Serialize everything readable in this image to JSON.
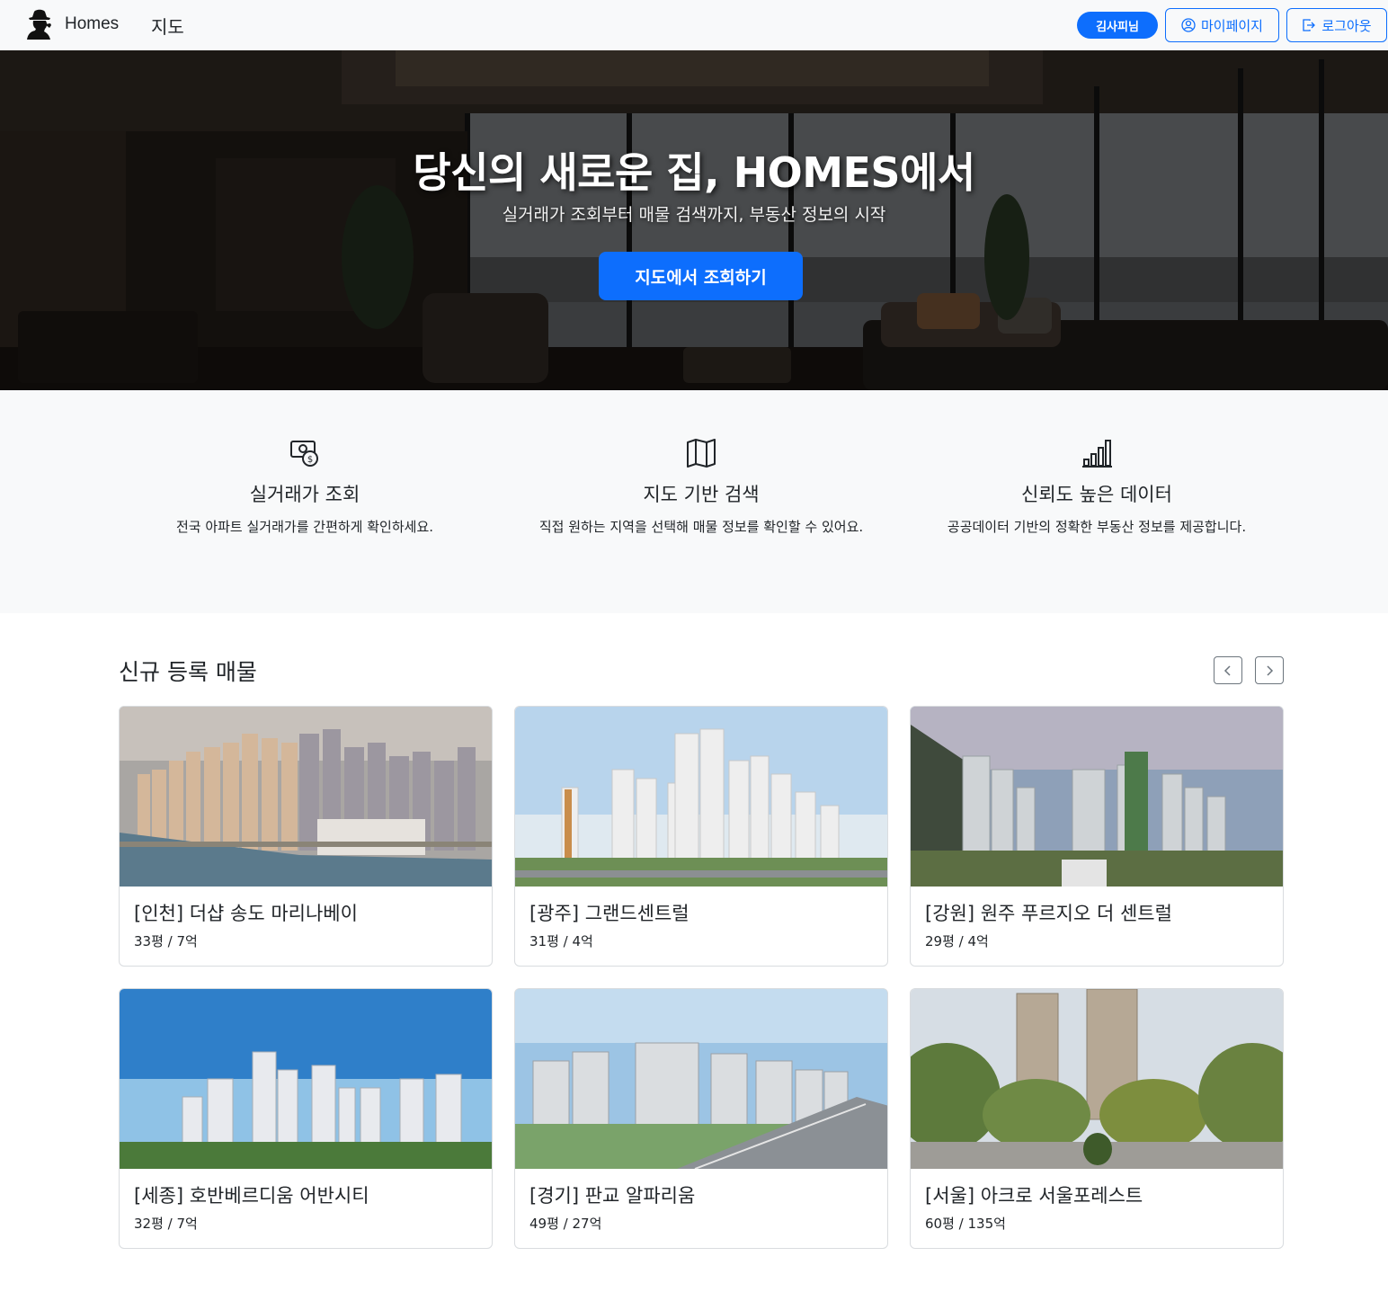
{
  "navbar": {
    "brand": "Homes",
    "map_link": "지도",
    "user_badge": "김사피님",
    "mypage_label": "마이페이지",
    "logout_label": "로그아웃",
    "brand_icon": "detective-silhouette-icon",
    "mypage_icon": "person-circle-icon",
    "logout_icon": "box-arrow-right-icon"
  },
  "hero": {
    "title": "당신의 새로운 집, HOMES에서",
    "subtitle": "실거래가 조회부터 매물 검색까지, 부동산 정보의 시작",
    "cta": "지도에서 조회하기"
  },
  "features": [
    {
      "icon": "cash-coin-icon",
      "title": "실거래가 조회",
      "desc": "전국 아파트 실거래가를 간편하게 확인하세요."
    },
    {
      "icon": "map-icon",
      "title": "지도 기반 검색",
      "desc": "직접 원하는 지역을 선택해 매물 정보를 확인할 수 있어요."
    },
    {
      "icon": "bar-chart-icon",
      "title": "신뢰도 높은 데이터",
      "desc": "공공데이터 기반의 정확한 부동산 정보를 제공합니다."
    }
  ],
  "listings": {
    "title": "신규 등록 매물",
    "prev_icon": "chevron-left-icon",
    "next_icon": "chevron-right-icon",
    "items": [
      {
        "title": "[인천] 더샵 송도 마리나베이",
        "meta": "33평 / 7억"
      },
      {
        "title": "[광주] 그랜드센트럴",
        "meta": "31평 / 4억"
      },
      {
        "title": "[강원] 원주 푸르지오 더 센트럴",
        "meta": "29평 / 4억"
      },
      {
        "title": "[세종] 호반베르디움 어반시티",
        "meta": "32평 / 7억"
      },
      {
        "title": "[경기] 판교 알파리움",
        "meta": "49평 / 27억"
      },
      {
        "title": "[서울] 아크로 서울포레스트",
        "meta": "60평 / 135억"
      }
    ]
  },
  "colors": {
    "primary": "#0d6efd",
    "navbar_bg": "#f8f9fa",
    "features_bg": "#f8f9fa",
    "text": "#212529"
  }
}
